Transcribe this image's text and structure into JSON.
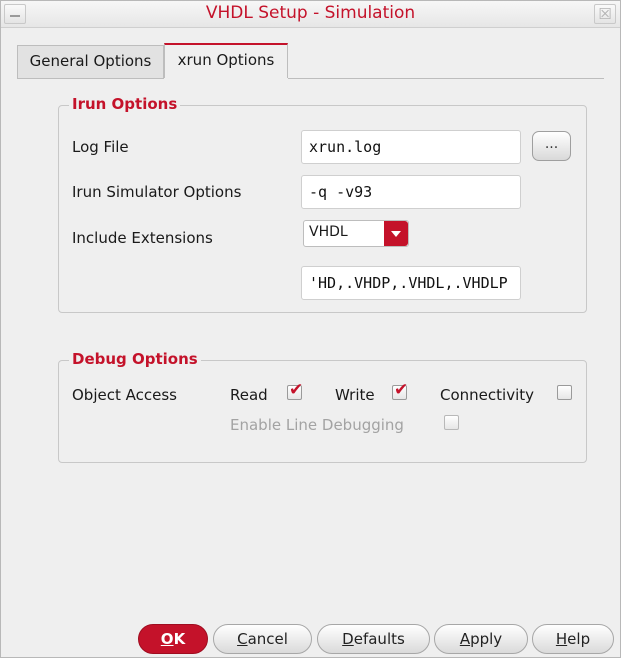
{
  "window": {
    "title": "VHDL Setup - Simulation",
    "close_glyph": "☒",
    "accent_color": "#c4122a"
  },
  "tabs": [
    {
      "label": "General Options",
      "active": false
    },
    {
      "label": "xrun Options",
      "active": true
    }
  ],
  "irun_options": {
    "title": "Irun Options",
    "log_file": {
      "label": "Log File",
      "value": "xrun.log",
      "browse_label": "..."
    },
    "simulator_options": {
      "label": "Irun Simulator Options",
      "value": "-q -v93"
    },
    "include_extensions": {
      "label": "Include Extensions",
      "selected": "VHDL",
      "value": "'HD,.VHDP,.VHDL,.VHDLP"
    }
  },
  "debug_options": {
    "title": "Debug Options",
    "object_access_label": "Object Access",
    "read": {
      "label": "Read",
      "checked": true
    },
    "write": {
      "label": "Write",
      "checked": true
    },
    "connectivity": {
      "label": "Connectivity",
      "checked": false
    },
    "line_debugging": {
      "label": "Enable Line Debugging",
      "checked": false,
      "enabled": false
    }
  },
  "buttons": {
    "ok": {
      "mnemonic": "O",
      "rest": "K"
    },
    "cancel": {
      "mnemonic": "C",
      "rest": "ancel"
    },
    "defaults": {
      "mnemonic": "D",
      "rest": "efaults"
    },
    "apply": {
      "mnemonic": "A",
      "rest": "pply"
    },
    "help": {
      "mnemonic": "H",
      "rest": "elp"
    }
  },
  "check_glyph": "✔"
}
